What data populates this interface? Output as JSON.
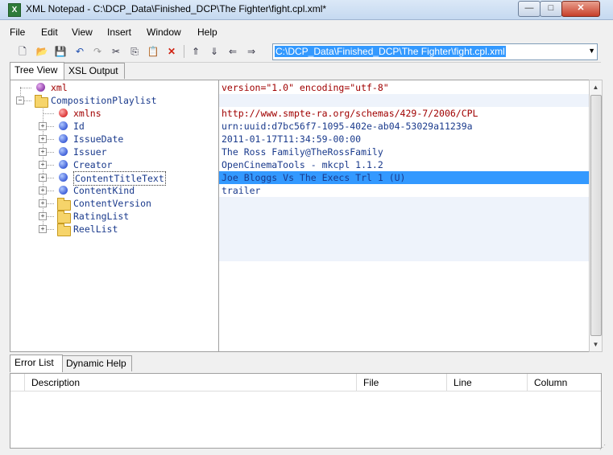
{
  "window": {
    "title": "XML Notepad - C:\\DCP_Data\\Finished_DCP\\The Fighter\\fight.cpl.xml*",
    "app_icon": "X",
    "minimize_label": "—",
    "maximize_label": "□",
    "close_label": "✕"
  },
  "menu": [
    "File",
    "Edit",
    "View",
    "Insert",
    "Window",
    "Help"
  ],
  "toolbar": {
    "icons": [
      "new-icon",
      "open-icon",
      "save-icon",
      "undo-icon",
      "redo-icon",
      "cut-icon",
      "copy-icon",
      "paste-icon",
      "delete-icon",
      "nudge-up-icon",
      "nudge-down-icon",
      "nudge-left-icon",
      "nudge-right-icon"
    ],
    "address_value": "C:\\DCP_Data\\Finished_DCP\\The Fighter\\fight.cpl.xml"
  },
  "tabs_top": [
    "Tree View",
    "XSL Output"
  ],
  "tree": [
    {
      "label": "xml",
      "kind": "pi",
      "depth": 0,
      "expander": false
    },
    {
      "label": "CompositionPlaylist",
      "kind": "folder",
      "depth": 0,
      "expander": "-"
    },
    {
      "label": "xmlns",
      "kind": "attr",
      "depth": 1,
      "expander": false
    },
    {
      "label": "Id",
      "kind": "element",
      "depth": 1,
      "expander": "+"
    },
    {
      "label": "IssueDate",
      "kind": "element",
      "depth": 1,
      "expander": "+"
    },
    {
      "label": "Issuer",
      "kind": "element",
      "depth": 1,
      "expander": "+"
    },
    {
      "label": "Creator",
      "kind": "element",
      "depth": 1,
      "expander": "+"
    },
    {
      "label": "ContentTitleText",
      "kind": "element",
      "depth": 1,
      "expander": "+",
      "selected": true
    },
    {
      "label": "ContentKind",
      "kind": "element",
      "depth": 1,
      "expander": "+"
    },
    {
      "label": "ContentVersion",
      "kind": "folder",
      "depth": 1,
      "expander": "+"
    },
    {
      "label": "RatingList",
      "kind": "folder",
      "depth": 1,
      "expander": "+"
    },
    {
      "label": "ReelList",
      "kind": "folder",
      "depth": 1,
      "expander": "+"
    }
  ],
  "values": [
    {
      "text": "version=\"1.0\" encoding=\"utf-8\"",
      "style": "attr"
    },
    {
      "text": "",
      "style": "shade"
    },
    {
      "text": "http://www.smpte-ra.org/schemas/429-7/2006/CPL",
      "style": "attr"
    },
    {
      "text": "urn:uuid:d7bc56f7-1095-402e-ab04-53029a11239a",
      "style": ""
    },
    {
      "text": "2011-01-17T11:34:59-00:00",
      "style": ""
    },
    {
      "text": "The Ross Family@TheRossFamily",
      "style": ""
    },
    {
      "text": "OpenCinemaTools - mkcpl 1.1.2",
      "style": ""
    },
    {
      "text": "Joe Bloggs Vs The Execs Trl 1 (U)",
      "style": "sel"
    },
    {
      "text": "trailer",
      "style": ""
    },
    {
      "text": "",
      "style": "shade"
    },
    {
      "text": "",
      "style": "shade"
    },
    {
      "text": "",
      "style": "shade"
    }
  ],
  "tabs_bottom": [
    "Error List",
    "Dynamic Help"
  ],
  "error_columns": [
    "Description",
    "File",
    "Line",
    "Column"
  ],
  "colors": {
    "selection": "#3399ff",
    "element_text": "#1a3a8c",
    "attr_text": "#a00000"
  }
}
